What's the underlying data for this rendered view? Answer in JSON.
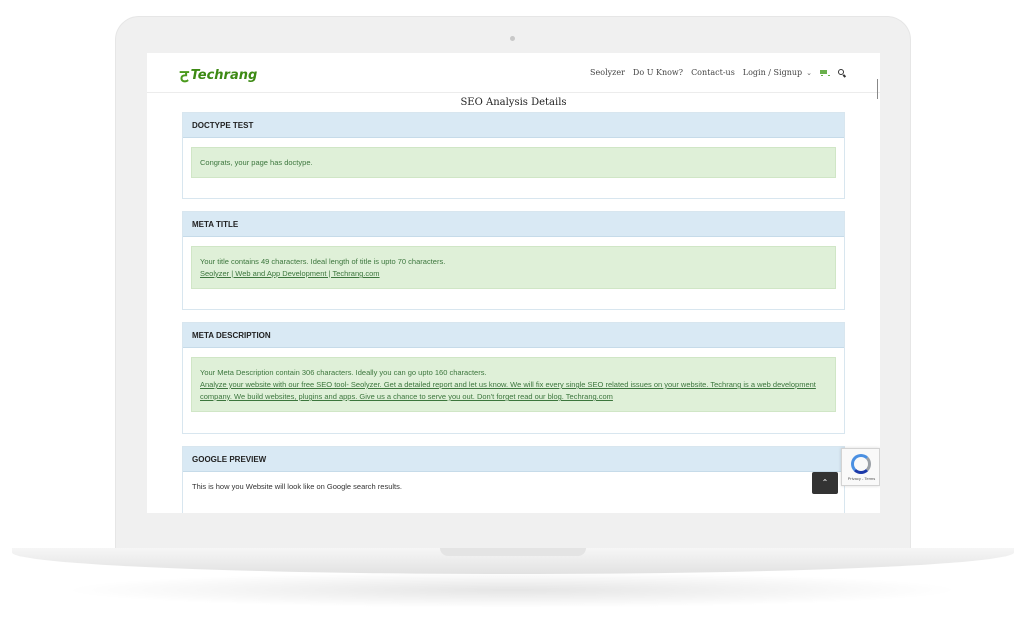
{
  "header": {
    "logo_mark": "ट",
    "logo_text": "Techrang",
    "nav": [
      "Seolyzer",
      "Do U Know?",
      "Contact-us",
      "Login / Signup"
    ],
    "nav_chevron": "⌄",
    "icons": [
      "cart-icon",
      "search-icon"
    ]
  },
  "page": {
    "title": "SEO Analysis Details"
  },
  "panels": {
    "doctype": {
      "title": "DOCTYPE TEST",
      "message": "Congrats, your page has doctype."
    },
    "meta_title": {
      "title": "META TITLE",
      "message": "Your title contains 49 characters. Ideal length of title is upto 70 characters.",
      "value": "Seolyzer | Web and App Development | Techrang.com"
    },
    "meta_description": {
      "title": "META DESCRIPTION",
      "message": "Your Meta Description contain 306 characters. Ideally you can go upto 160 characters.",
      "value": "Analyze your website with our free SEO tool- Seolyzer. Get a detailed report and let us know. We will fix every single SEO related issues on your website. Techrang is a web development company. We build websites, plugins and apps. Give us a chance to serve you out. Don't forget read our blog. Techrang.com"
    },
    "google_preview": {
      "title": "GOOGLE PREVIEW",
      "message": "This is how you Website will look like on Google search results."
    }
  },
  "recaptcha": {
    "text": "Privacy - Terms"
  },
  "scroll_top": {
    "label": "⌃"
  },
  "colors": {
    "brand": "#3d8a14",
    "panel_header": "#d9e9f4",
    "alert_bg": "#dff0d8",
    "alert_text": "#3c763d"
  }
}
